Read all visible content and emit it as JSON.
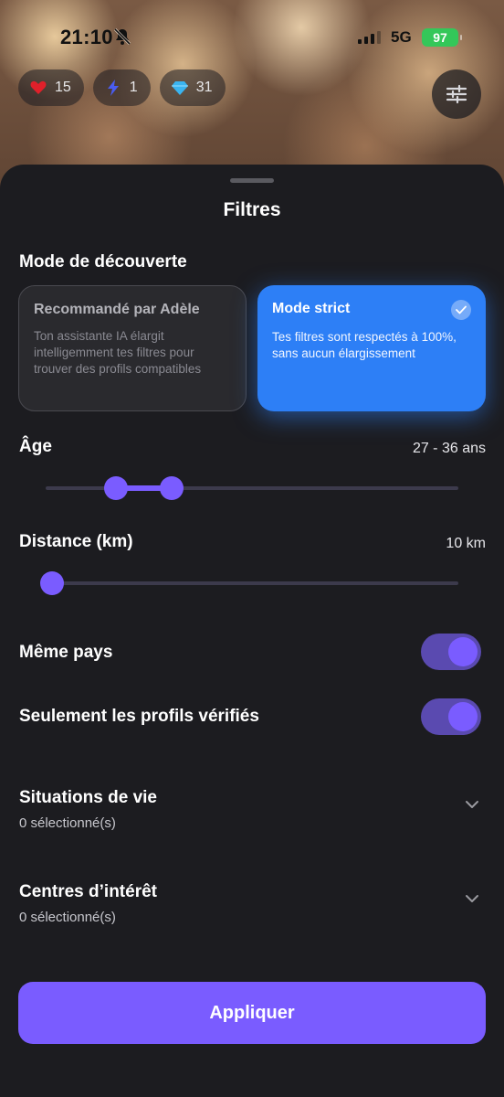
{
  "status_bar": {
    "time": "21:10",
    "network": "5G",
    "battery": "97"
  },
  "counters": [
    {
      "icon": "heart-icon",
      "value": "15",
      "color": "#e0202a"
    },
    {
      "icon": "lightning-icon",
      "value": "1",
      "color": "#4a5cf0"
    },
    {
      "icon": "diamond-icon",
      "value": "31",
      "color": "#3ab4f0"
    }
  ],
  "sheet": {
    "title": "Filtres",
    "discovery": {
      "label": "Mode de découverte",
      "recommended": {
        "title": "Recommandé par Adèle",
        "desc": "Ton assistante IA élargit intelligemment tes filtres pour trouver des profils compatibles"
      },
      "strict": {
        "title": "Mode strict",
        "desc": "Tes filtres sont respectés à 100%, sans aucun élargissement",
        "selected": true
      }
    },
    "age": {
      "label": "Âge",
      "value": "27 - 36 ans",
      "low_fraction": 0.15,
      "high_fraction": 0.293
    },
    "distance": {
      "label": "Distance (km)",
      "value": "10 km",
      "fraction": 0.0
    },
    "same_country": {
      "label": "Même pays",
      "on": true
    },
    "verified_only": {
      "label": "Seulement les profils vérifiés",
      "on": true
    },
    "life_situations": {
      "label": "Situations de vie",
      "sub": "0 sélectionné(s)"
    },
    "interests": {
      "label": "Centres d’intérêt",
      "sub": "0 sélectionné(s)"
    },
    "apply": "Appliquer"
  },
  "colors": {
    "accent": "#7a5cff",
    "selected_card": "#2d7ff6",
    "sheet_bg": "#1c1c20"
  }
}
